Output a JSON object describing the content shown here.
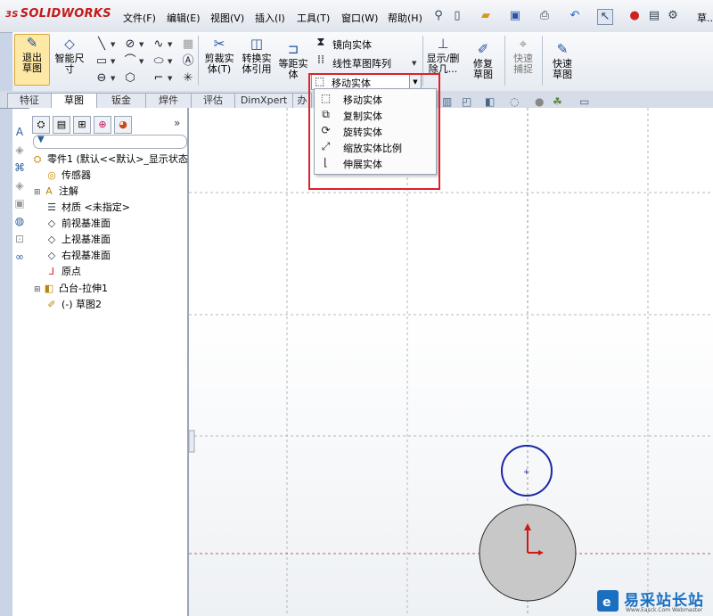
{
  "app": {
    "logo": "SOLIDWORKS",
    "logo_prefix": "3S"
  },
  "menubar": {
    "items": [
      "文件(F)",
      "编辑(E)",
      "视图(V)",
      "插入(I)",
      "工具(T)",
      "窗口(W)",
      "帮助(H)"
    ],
    "right_text": "草..."
  },
  "commands": {
    "exit_sketch": "退出草图",
    "smart_dimension": "智能尺寸",
    "trim": "剪裁实体(T)",
    "convert": "转换实体引用",
    "offset": "等距实体",
    "mirror": "镜向实体",
    "linear_pattern": "线性草图阵列",
    "show_delete": "显示/删除几...",
    "repair": "修复草图",
    "quick_snap": "快速捕捉",
    "rapid_sketch": "快速草图",
    "move_combo": "移动实体"
  },
  "tabs": [
    "特征",
    "草图",
    "钣金",
    "焊件",
    "评估",
    "DimXpert",
    "办公"
  ],
  "active_tab": "草图",
  "dropdown": {
    "items": [
      "移动实体",
      "复制实体",
      "旋转实体",
      "缩放实体比例",
      "伸展实体"
    ]
  },
  "tree": {
    "root": "零件1 (默认<<默认>_显示状态",
    "items": [
      "传感器",
      "注解",
      "材质 <未指定>",
      "前视基准面",
      "上视基准面",
      "右视基准面",
      "原点",
      "凸台-拉伸1",
      "(-) 草图2"
    ]
  },
  "panel": {
    "collapse": "»"
  },
  "watermark": {
    "text": "易采站长站",
    "sub": "Www.Easck.Com Webmaster"
  },
  "colors": {
    "highlight": "#e0202a",
    "circle_stroke": "#1a27a8",
    "filled_circle": "#c8c8c8",
    "origin": "#d01818"
  }
}
